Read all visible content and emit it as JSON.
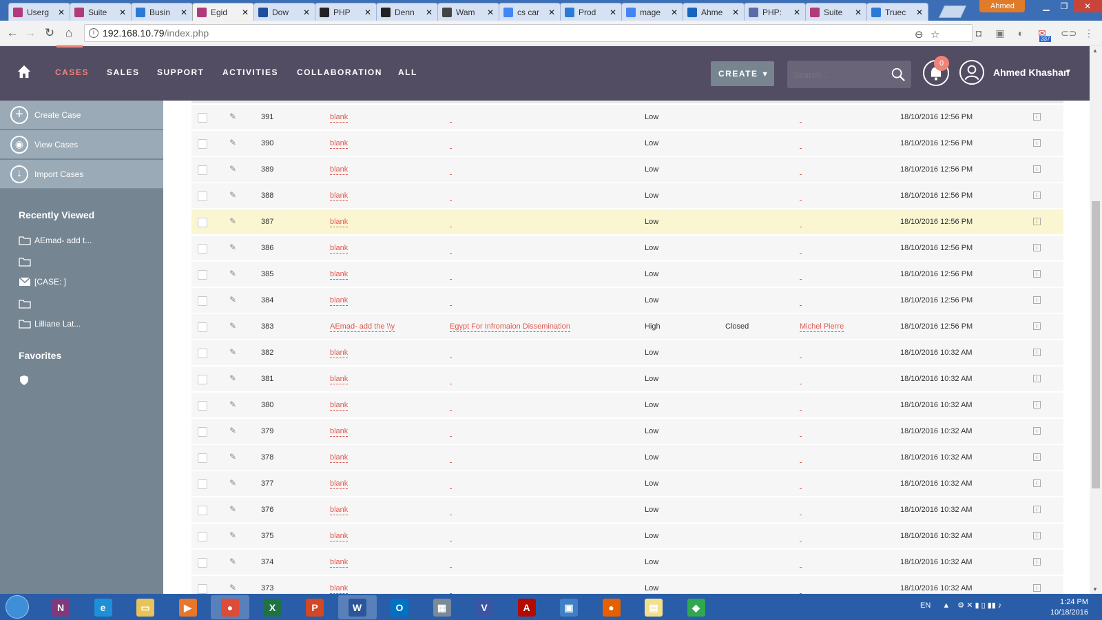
{
  "browser": {
    "tabs": [
      {
        "title": "Userg",
        "color": "#b03a7a"
      },
      {
        "title": "Suite",
        "color": "#b03a7a"
      },
      {
        "title": "Busin",
        "color": "#2a7bd6"
      },
      {
        "title": "Egid",
        "color": "#b03a7a",
        "active": true
      },
      {
        "title": "Dow",
        "color": "#1d4fa0"
      },
      {
        "title": "PHP",
        "color": "#222222"
      },
      {
        "title": "Denn",
        "color": "#222222"
      },
      {
        "title": "Wam",
        "color": "#444444"
      },
      {
        "title": "cs car",
        "color": "#4285f4"
      },
      {
        "title": "Prod",
        "color": "#2a7bd6"
      },
      {
        "title": "mage",
        "color": "#4285f4"
      },
      {
        "title": "Ahme",
        "color": "#1565c0"
      },
      {
        "title": "PHP:",
        "color": "#5b6aa8"
      },
      {
        "title": "Suite",
        "color": "#b03a7a"
      },
      {
        "title": "Truec",
        "color": "#2a7bd6"
      }
    ],
    "user_profile": "Ahmed",
    "url_host": "192.168.10.79",
    "url_path": "/index.php",
    "gmail_count": "337"
  },
  "nav": {
    "items": [
      "CASES",
      "SALES",
      "SUPPORT",
      "ACTIVITIES",
      "COLLABORATION",
      "ALL"
    ],
    "active": "CASES",
    "create_label": "CREATE",
    "search_placeholder": "Search...",
    "notification_count": "0",
    "user_name": "Ahmed Khashan"
  },
  "sidebar": {
    "actions": [
      "Create Case",
      "View Cases",
      "Import Cases"
    ],
    "recently_viewed_title": "Recently Viewed",
    "recently_viewed": [
      {
        "label": "AEmad- add t...",
        "icon": "folder"
      },
      {
        "label": "",
        "icon": "folder"
      },
      {
        "label": "[CASE: ]",
        "icon": "envelope"
      },
      {
        "label": "",
        "icon": "folder"
      },
      {
        "label": "Lilliane Lat...",
        "icon": "folder"
      }
    ],
    "favorites_title": "Favorites"
  },
  "cases": [
    {
      "num": "391",
      "subject": "blank",
      "account": "",
      "priority": "Low",
      "status": "",
      "user": "",
      "date": "18/10/2016 12:56 PM"
    },
    {
      "num": "390",
      "subject": "blank",
      "account": "",
      "priority": "Low",
      "status": "",
      "user": "",
      "date": "18/10/2016 12:56 PM"
    },
    {
      "num": "389",
      "subject": "blank",
      "account": "",
      "priority": "Low",
      "status": "",
      "user": "",
      "date": "18/10/2016 12:56 PM"
    },
    {
      "num": "388",
      "subject": "blank",
      "account": "",
      "priority": "Low",
      "status": "",
      "user": "",
      "date": "18/10/2016 12:56 PM"
    },
    {
      "num": "387",
      "subject": "blank",
      "account": "",
      "priority": "Low",
      "status": "",
      "user": "",
      "date": "18/10/2016 12:56 PM",
      "highlight": true
    },
    {
      "num": "386",
      "subject": "blank",
      "account": "",
      "priority": "Low",
      "status": "",
      "user": "",
      "date": "18/10/2016 12:56 PM"
    },
    {
      "num": "385",
      "subject": "blank",
      "account": "",
      "priority": "Low",
      "status": "",
      "user": "",
      "date": "18/10/2016 12:56 PM"
    },
    {
      "num": "384",
      "subject": "blank",
      "account": "",
      "priority": "Low",
      "status": "",
      "user": "",
      "date": "18/10/2016 12:56 PM"
    },
    {
      "num": "383",
      "subject": "AEmad- add the \\\\y",
      "account": "Egypt For Infromaion Dissemination",
      "priority": "High",
      "status": "Closed",
      "user": "Michel Pierre",
      "date": "18/10/2016 12:56 PM"
    },
    {
      "num": "382",
      "subject": "blank",
      "account": "",
      "priority": "Low",
      "status": "",
      "user": "",
      "date": "18/10/2016 10:32 AM"
    },
    {
      "num": "381",
      "subject": "blank",
      "account": "",
      "priority": "Low",
      "status": "",
      "user": "",
      "date": "18/10/2016 10:32 AM"
    },
    {
      "num": "380",
      "subject": "blank",
      "account": "",
      "priority": "Low",
      "status": "",
      "user": "",
      "date": "18/10/2016 10:32 AM"
    },
    {
      "num": "379",
      "subject": "blank",
      "account": "",
      "priority": "Low",
      "status": "",
      "user": "",
      "date": "18/10/2016 10:32 AM"
    },
    {
      "num": "378",
      "subject": "blank",
      "account": "",
      "priority": "Low",
      "status": "",
      "user": "",
      "date": "18/10/2016 10:32 AM"
    },
    {
      "num": "377",
      "subject": "blank",
      "account": "",
      "priority": "Low",
      "status": "",
      "user": "",
      "date": "18/10/2016 10:32 AM"
    },
    {
      "num": "376",
      "subject": "blank",
      "account": "",
      "priority": "Low",
      "status": "",
      "user": "",
      "date": "18/10/2016 10:32 AM"
    },
    {
      "num": "375",
      "subject": "blank",
      "account": "",
      "priority": "Low",
      "status": "",
      "user": "",
      "date": "18/10/2016 10:32 AM"
    },
    {
      "num": "374",
      "subject": "blank",
      "account": "",
      "priority": "Low",
      "status": "",
      "user": "",
      "date": "18/10/2016 10:32 AM"
    },
    {
      "num": "373",
      "subject": "blank",
      "account": "",
      "priority": "Low",
      "status": "",
      "user": "",
      "date": "18/10/2016 10:32 AM"
    }
  ],
  "taskbar": {
    "apps": [
      {
        "name": "onenote",
        "glyph": "N",
        "color": "#80397b"
      },
      {
        "name": "internet-explorer",
        "glyph": "e",
        "color": "#1e90d8"
      },
      {
        "name": "file-explorer",
        "glyph": "▭",
        "color": "#e8c35a"
      },
      {
        "name": "media-player",
        "glyph": "▶",
        "color": "#e8762b"
      },
      {
        "name": "chrome",
        "glyph": "●",
        "color": "#dd4b39",
        "selected": true
      },
      {
        "name": "excel",
        "glyph": "X",
        "color": "#1f7244"
      },
      {
        "name": "powerpoint",
        "glyph": "P",
        "color": "#d24726"
      },
      {
        "name": "word",
        "glyph": "W",
        "color": "#2b579a",
        "selected": true
      },
      {
        "name": "outlook",
        "glyph": "O",
        "color": "#0072c6"
      },
      {
        "name": "calculator",
        "glyph": "▦",
        "color": "#7a8a99"
      },
      {
        "name": "visio",
        "glyph": "V",
        "color": "#3955a3"
      },
      {
        "name": "acrobat",
        "glyph": "A",
        "color": "#b30b00"
      },
      {
        "name": "remote-desktop",
        "glyph": "▣",
        "color": "#3f7fc6"
      },
      {
        "name": "firefox",
        "glyph": "●",
        "color": "#e66000"
      },
      {
        "name": "sticky-notes",
        "glyph": "▤",
        "color": "#f2e08a"
      },
      {
        "name": "app-green",
        "glyph": "◆",
        "color": "#2fa84f"
      }
    ],
    "lang": "EN",
    "time": "1:24 PM",
    "date": "10/18/2016"
  }
}
